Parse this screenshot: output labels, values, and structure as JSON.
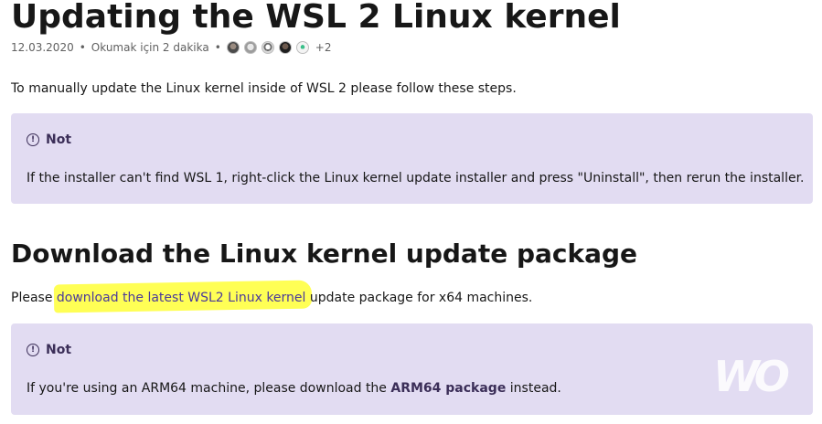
{
  "article": {
    "title": "Updating the WSL 2 Linux kernel",
    "date": "12.03.2020",
    "read_time": "Okumak için 2 dakika",
    "bullet": "•",
    "contributors_more": "+2",
    "intro": "To manually update the Linux kernel inside of WSL 2 please follow these steps."
  },
  "note1": {
    "title": "Not",
    "body": "If the installer can't find WSL 1, right-click the Linux kernel update installer and press \"Uninstall\", then rerun the installer."
  },
  "section2": {
    "heading": "Download the Linux kernel update package",
    "para_prefix": "Please ",
    "link_text": "download the latest WSL2 Linux kernel",
    "para_suffix": " update package for x64 machines."
  },
  "note2": {
    "title": "Not",
    "body_prefix": "If you're using an ARM64 machine, please download the ",
    "link_text": "ARM64 package",
    "body_suffix": " instead."
  },
  "watermark": {
    "text": "WO"
  },
  "icons": {
    "note_icon": "info-circle-icon"
  },
  "colors": {
    "note_bg": "#e2dcf2",
    "note_accent": "#3b2e58",
    "link": "#4b3a9a",
    "highlight": "#ffff55"
  }
}
